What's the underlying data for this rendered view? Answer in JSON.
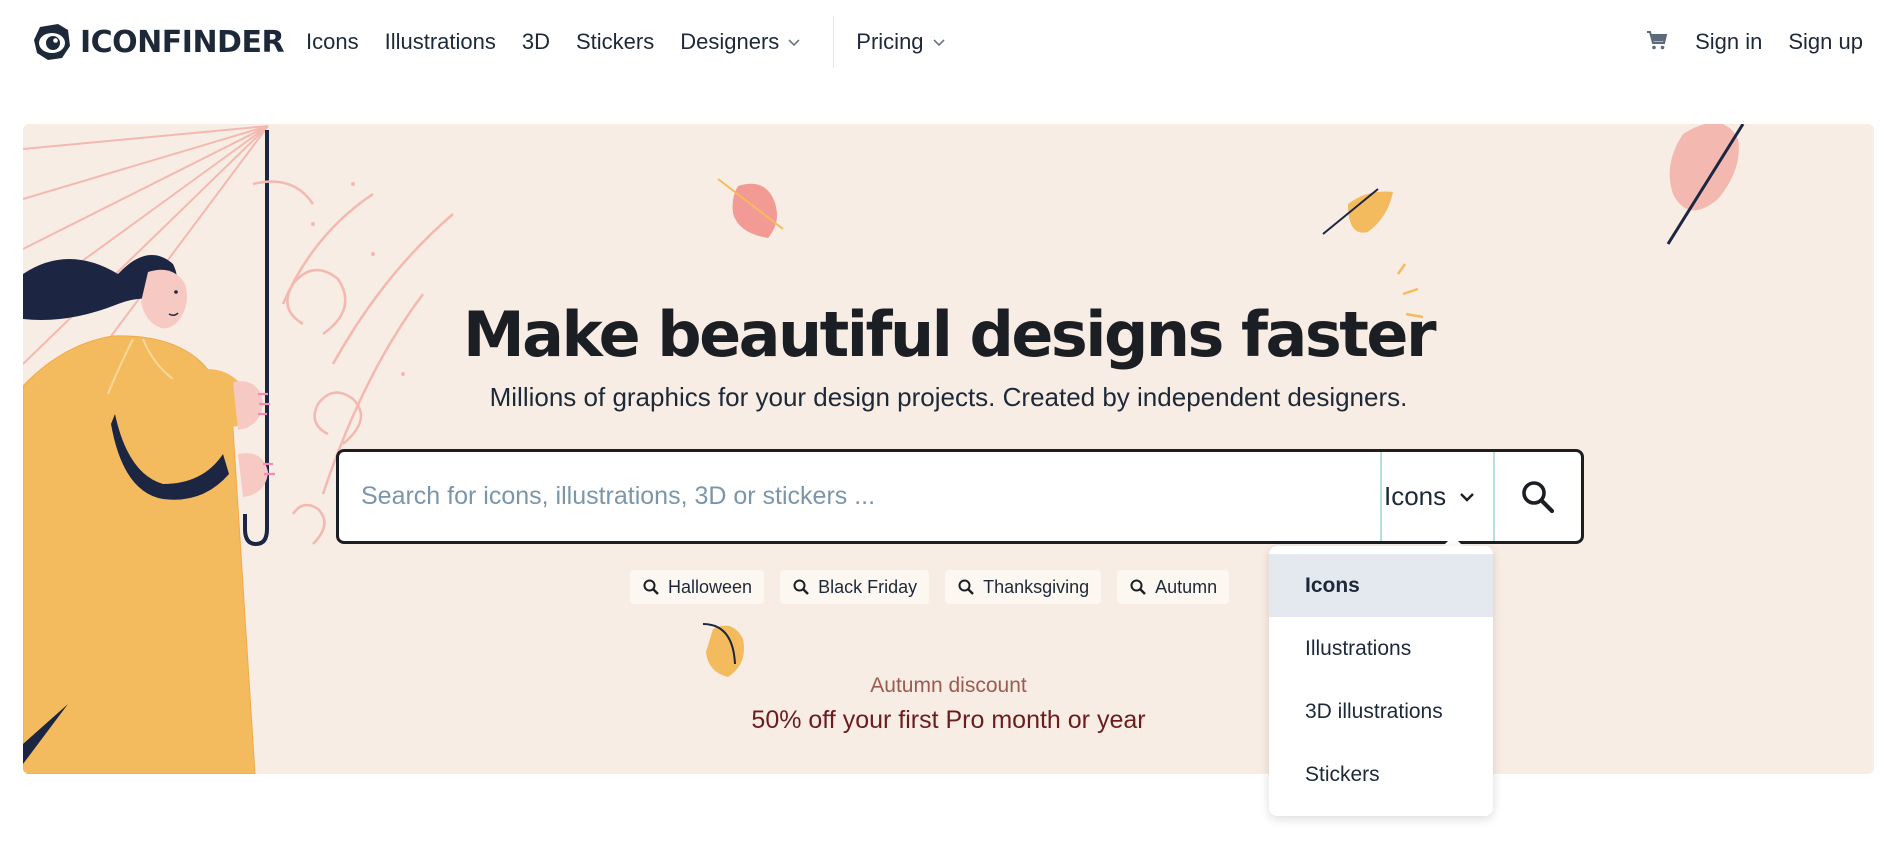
{
  "header": {
    "brand": "ICONFINDER",
    "nav": [
      {
        "label": "Icons"
      },
      {
        "label": "Illustrations"
      },
      {
        "label": "3D"
      },
      {
        "label": "Stickers"
      },
      {
        "label": "Designers",
        "has_dropdown": true
      }
    ],
    "pricing": {
      "label": "Pricing",
      "has_dropdown": true
    },
    "sign_in": "Sign in",
    "sign_up": "Sign up"
  },
  "hero": {
    "title": "Make beautiful designs faster",
    "subtitle": "Millions of graphics for your design projects. Created by independent designers.",
    "search": {
      "placeholder": "Search for icons, illustrations, 3D or stickers ...",
      "value": "",
      "type_selected": "Icons"
    },
    "tags": [
      "Halloween",
      "Black Friday",
      "Thanksgiving",
      "Autumn"
    ],
    "promo_label": "Autumn discount",
    "promo_text": "50% off your first Pro month or year"
  },
  "dropdown": {
    "options": [
      "Icons",
      "Illustrations",
      "3D illustrations",
      "Stickers"
    ],
    "selected": "Icons"
  },
  "colors": {
    "hero_background": "#f8ede4",
    "text_dark": "#1b1f24",
    "placeholder": "#7b96aa",
    "promo_label": "#9b5b50",
    "promo_text": "#6b1d1d",
    "dropdown_active": "#e4e8ef",
    "illustration_yellow": "#f4bb5e",
    "illustration_pink": "#f4b8b0",
    "illustration_navy": "#1c2541"
  },
  "icons": {
    "brand": "eye-logo-icon",
    "cart": "shopping-cart-icon",
    "search": "magnifier-icon",
    "dropdown": "chevron-down-icon"
  }
}
